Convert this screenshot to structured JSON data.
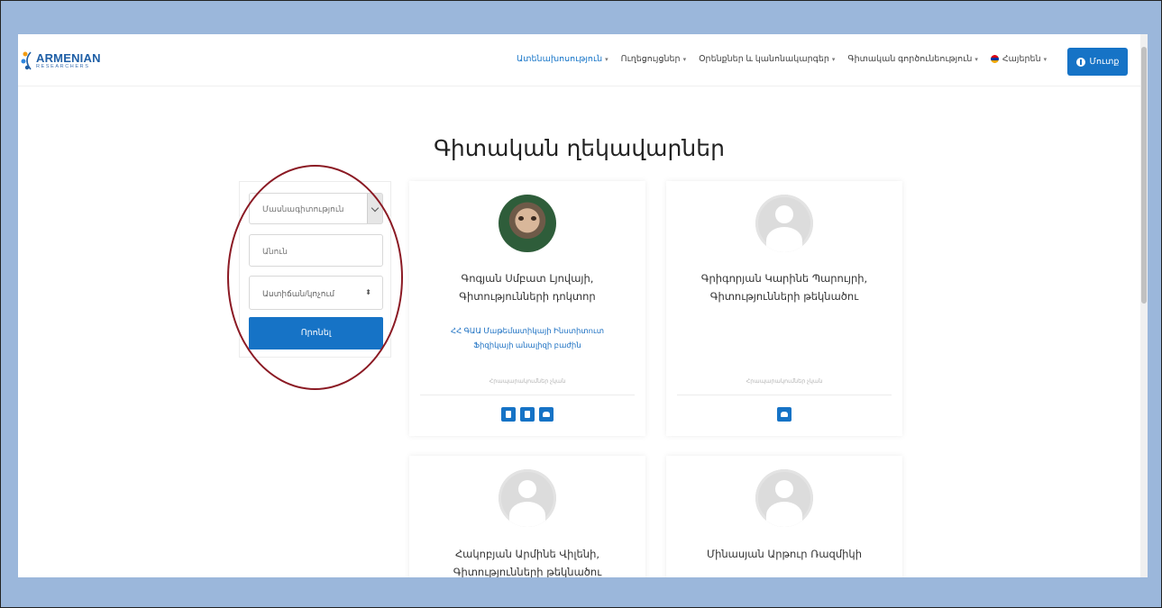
{
  "header": {
    "logo_text": "ARMENIAN",
    "logo_sub": "RESEARCHERS",
    "nav": [
      {
        "label": "Ատենախոսություն",
        "active": true
      },
      {
        "label": "Ուղեցույցներ",
        "active": false
      },
      {
        "label": "Օրենքներ և կանոնակարգեր",
        "active": false
      },
      {
        "label": "Գիտական գործունեություն",
        "active": false
      },
      {
        "label": "Հայերեն",
        "active": false
      }
    ],
    "login_label": "Մուտք",
    "brand_color": "#1673c6",
    "icons": [
      "logo-mark",
      "flag-am-icon",
      "user-circle-icon"
    ]
  },
  "page": {
    "title": "Գիտական ղեկավարներ"
  },
  "filter": {
    "specialty_placeholder": "Մասնագիտություն",
    "name_placeholder": "Անուն",
    "degree_placeholder": "Աստիճան/կոչում",
    "search_label": "Որոնել"
  },
  "cards": [
    {
      "name": "Գոգյան Սմբատ Լյովայի,\nԳիտությունների դոկտոր",
      "institute": "ՀՀ ԳԱԱ Մաթեմատիկայի Ինստիտուտ\nՖիզիկայի անալիզի բաժին",
      "note": "Հրապարակումներ չկան",
      "avatar": "photo",
      "icons": [
        "building-icon",
        "document-icon",
        "group-icon"
      ]
    },
    {
      "name": "Գրիգորյան Կարինե Պարույրի,\nԳիտությունների թեկնածու",
      "institute": "",
      "note": "Հրապարակումներ չկան",
      "avatar": "placeholder",
      "icons": [
        "group-icon"
      ]
    },
    {
      "name": "Հակոբյան Արմինե Վիլենի,\nԳիտությունների թեկնածու",
      "avatar": "placeholder"
    },
    {
      "name": "Մինասյան Արթուր Ռազմիկի",
      "avatar": "placeholder"
    }
  ],
  "annotation": {
    "color": "#8b1a24"
  }
}
